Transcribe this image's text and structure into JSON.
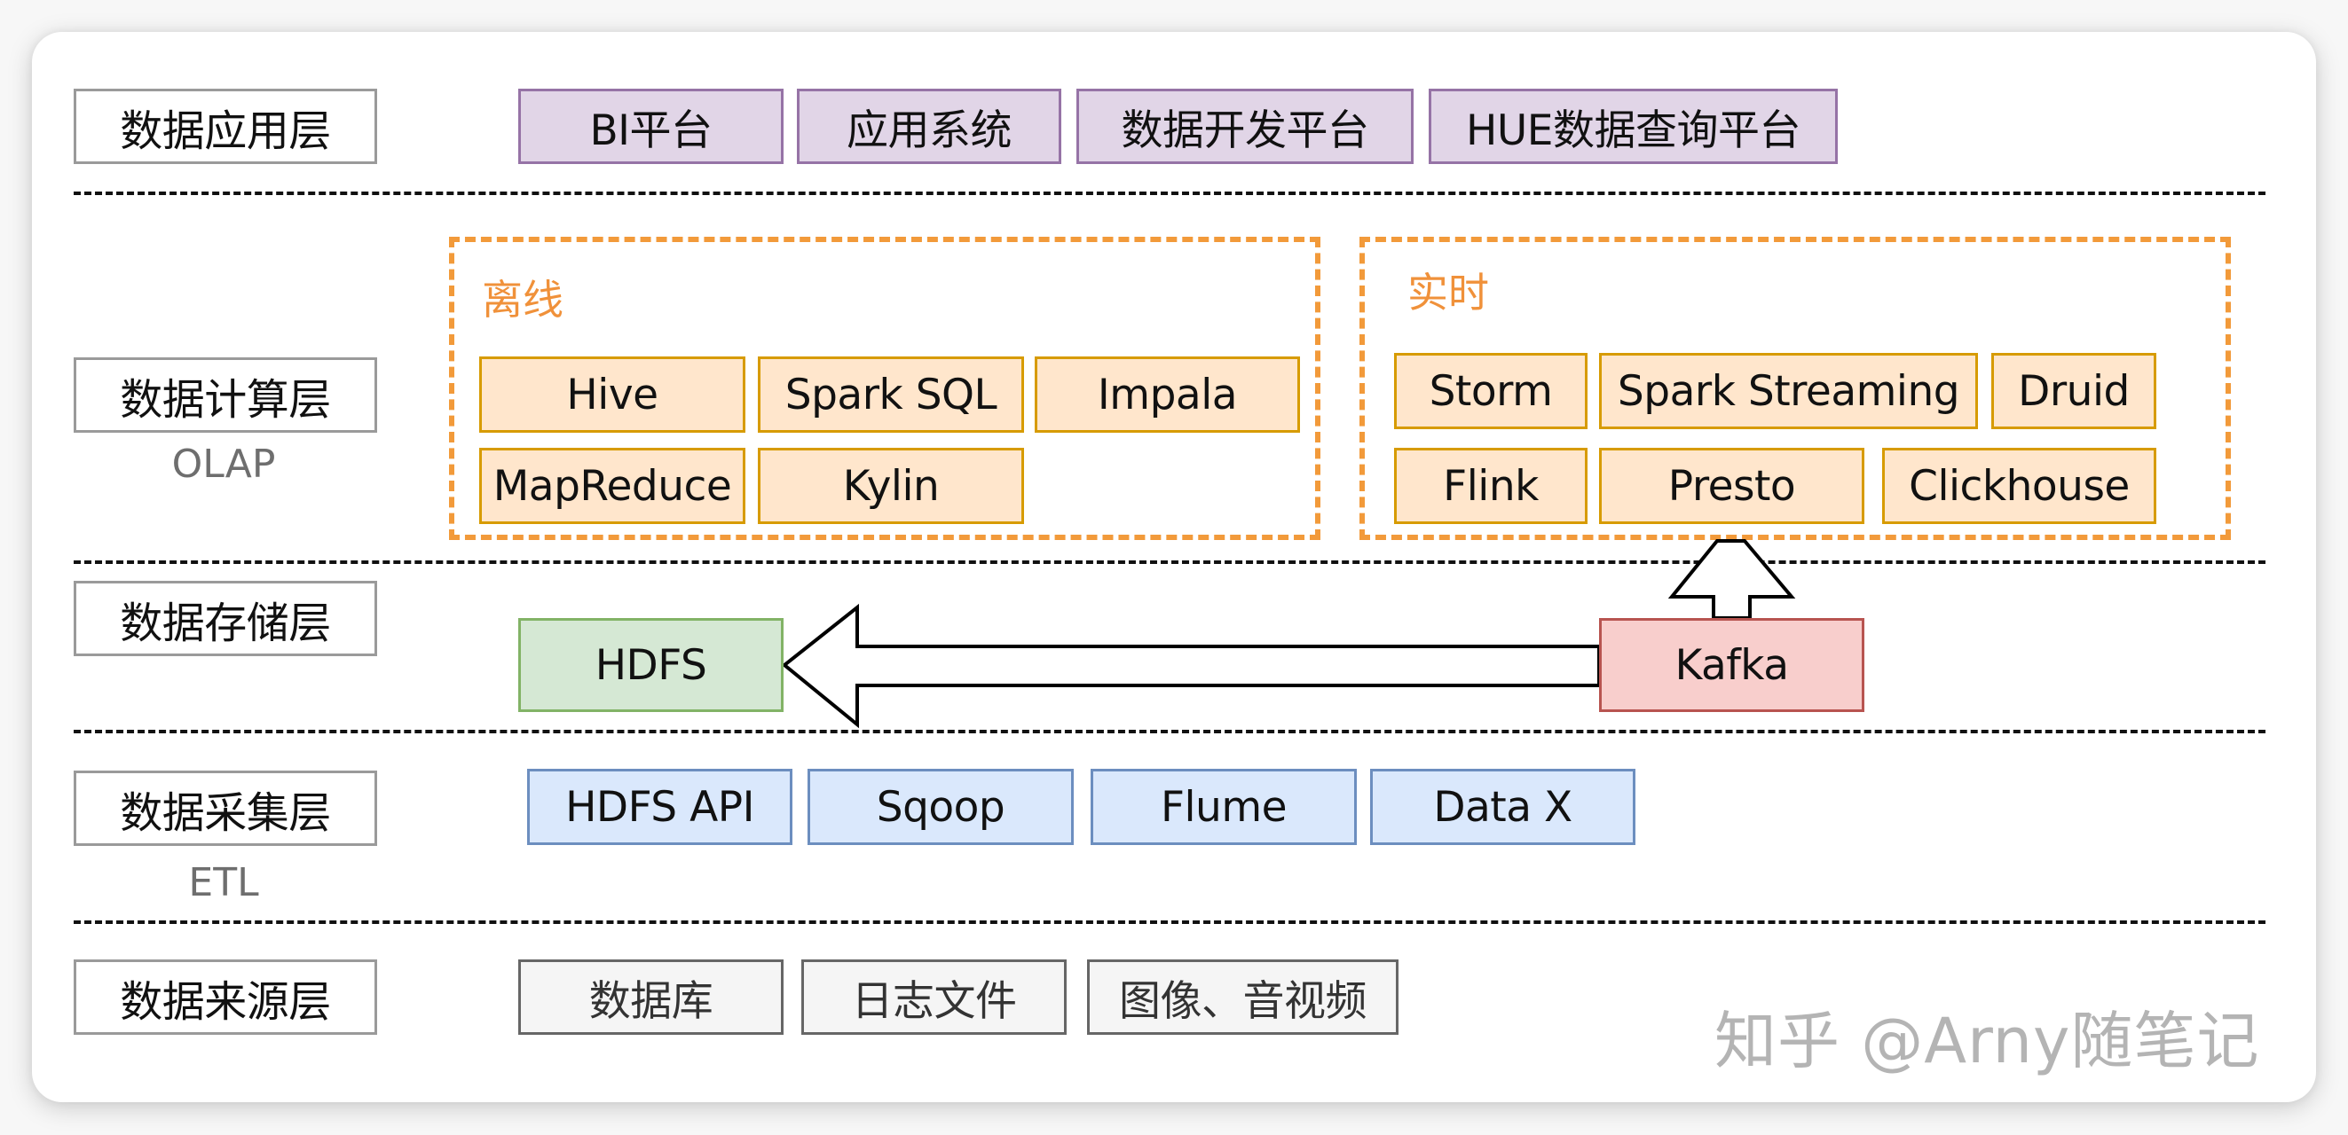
{
  "colors": {
    "application": {
      "fill": "#e1d5e7",
      "stroke": "#9673a6"
    },
    "compute": {
      "fill": "#ffe6cc",
      "stroke": "#d79b00"
    },
    "container": "#f29a3a",
    "storage_hdfs": {
      "fill": "#d5e8d4",
      "stroke": "#82b366"
    },
    "storage_kafka": {
      "fill": "#f8cecc",
      "stroke": "#b85450"
    },
    "collection": {
      "fill": "#dae8fc",
      "stroke": "#6c8ebf"
    },
    "source": {
      "fill": "#f5f5f5",
      "stroke": "#666666"
    }
  },
  "layers": {
    "application": {
      "label": "数据应用层",
      "items": [
        "BI平台",
        "应用系统",
        "数据开发平台",
        "HUE数据查询平台"
      ]
    },
    "compute": {
      "label": "数据计算层",
      "sublabel": "OLAP",
      "offline": {
        "title": "离线",
        "items": [
          "Hive",
          "Spark SQL",
          "Impala",
          "MapReduce",
          "Kylin"
        ]
      },
      "realtime": {
        "title": "实时",
        "items": [
          "Storm",
          "Spark Streaming",
          "Druid",
          "Flink",
          "Presto",
          "Clickhouse"
        ]
      }
    },
    "storage": {
      "label": "数据存储层",
      "items": [
        "HDFS",
        "Kafka"
      ]
    },
    "collection": {
      "label": "数据采集层",
      "sublabel": "ETL",
      "items": [
        "HDFS API",
        "Sqoop",
        "Flume",
        "Data X"
      ]
    },
    "source": {
      "label": "数据来源层",
      "items": [
        "数据库",
        "日志文件",
        "图像、音视频"
      ]
    }
  },
  "flows": [
    {
      "from": "Kafka",
      "to": "HDFS",
      "direction": "left"
    },
    {
      "from": "Kafka",
      "to": "实时",
      "direction": "up"
    }
  ],
  "watermark": "知乎 @Arny随笔记"
}
